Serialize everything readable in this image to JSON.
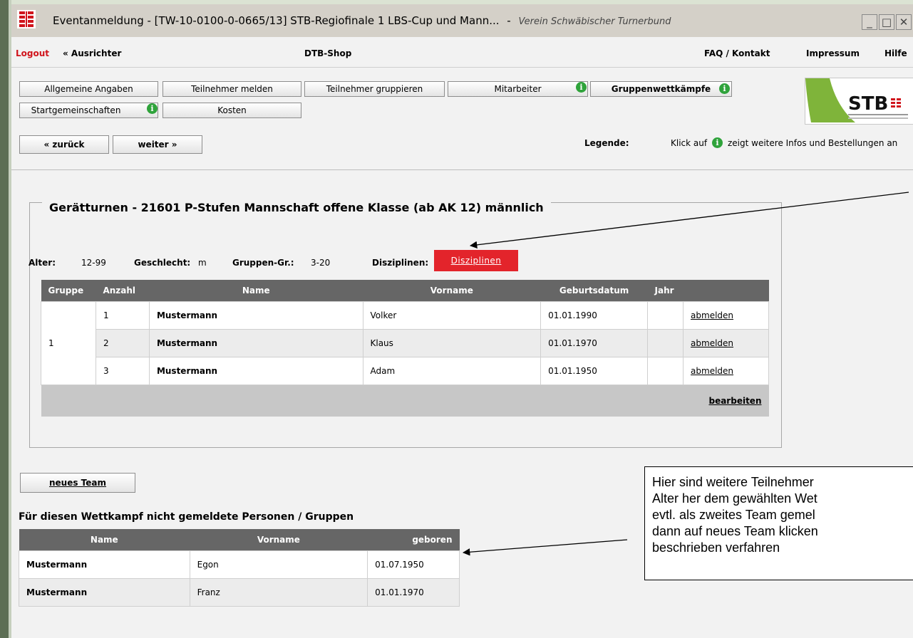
{
  "window": {
    "title": "Eventanmeldung  -  [TW-10-0100-0-0665/13] STB-Regiofinale 1 LBS-Cup und Mann...",
    "title_sep": "-",
    "subtitle": "Verein Schwäbischer Turnerbund"
  },
  "topnav": {
    "logout": "Logout",
    "ausrichter": "« Ausrichter",
    "shop": "DTB-Shop",
    "faq": "FAQ / Kontakt",
    "impressum": "Impressum",
    "hilfe": "Hilfe"
  },
  "tabs": {
    "allgemeine": "Allgemeine Angaben",
    "teilnehmer_melden": "Teilnehmer melden",
    "teilnehmer_gruppieren": "Teilnehmer gruppieren",
    "mitarbeiter": "Mitarbeiter",
    "gruppenwettkaempfe": "Gruppenwettkämpfe",
    "startgemeinschaften": "Startgemeinschaften",
    "kosten": "Kosten"
  },
  "nav": {
    "back": "« zurück",
    "next": "weiter »"
  },
  "legend": {
    "label": "Legende:",
    "text_before": "Klick auf",
    "text_after": "zeigt weitere Infos und Bestellungen an"
  },
  "logo": {
    "text": "STB"
  },
  "competition": {
    "title": "Gerätturnen - 21601 P-Stufen Mannschaft offene Klasse (ab AK 12) männlich",
    "alter_label": "Alter:",
    "alter_value": "12-99",
    "geschlecht_label": "Geschlecht:",
    "geschlecht_value": "m",
    "gruppen_label": "Gruppen-Gr.:",
    "gruppen_value": "3-20",
    "disziplinen_label": "Disziplinen:",
    "disziplinen_button": "Disziplinen"
  },
  "team_table": {
    "headers": [
      "Gruppe",
      "Anzahl",
      "Name",
      "Vorname",
      "Geburtsdatum",
      "Jahr"
    ],
    "group": "1",
    "rows": [
      {
        "anzahl": "1",
        "name": "Mustermann",
        "vorname": "Volker",
        "geburtsdatum": "01.01.1990",
        "jahr": "",
        "action": "abmelden"
      },
      {
        "anzahl": "2",
        "name": "Mustermann",
        "vorname": "Klaus",
        "geburtsdatum": "01.01.1970",
        "jahr": "",
        "action": "abmelden"
      },
      {
        "anzahl": "3",
        "name": "Mustermann",
        "vorname": "Adam",
        "geburtsdatum": "01.01.1950",
        "jahr": "",
        "action": "abmelden"
      }
    ],
    "footer_action": "bearbeiten"
  },
  "new_team_button": "neues Team",
  "unregistered": {
    "title": "Für diesen Wettkampf nicht gemeldete Personen / Gruppen",
    "headers": [
      "Name",
      "Vorname",
      "geboren"
    ],
    "rows": [
      {
        "name": "Mustermann",
        "vorname": "Egon",
        "geboren": "01.07.1950"
      },
      {
        "name": "Mustermann",
        "vorname": "Franz",
        "geboren": "01.01.1970"
      }
    ]
  },
  "note": {
    "lines": [
      "Hier sind weitere Teilnehmer",
      "Alter her dem gewählten Wet",
      "evtl. als zweites Team gemel",
      "dann auf neues Team klicken",
      "beschrieben verfahren"
    ]
  },
  "colors": {
    "disziplinen_button": "#e3242b",
    "logout": "#d0141c",
    "info_icon": "#2fa33b",
    "table_header": "#666666"
  },
  "icons": {
    "app": "stb-app-icon",
    "info": "info-icon"
  }
}
